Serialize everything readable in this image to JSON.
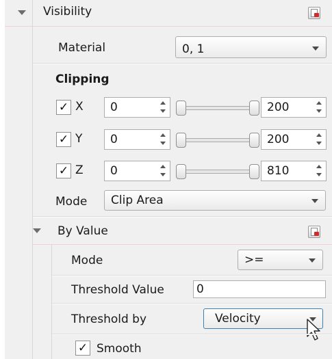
{
  "visibility": {
    "header_label": "Visibility",
    "material_label": "Material",
    "material_value": "0, 1",
    "clipping_title": "Clipping",
    "axes": [
      {
        "label": "X",
        "checked": true,
        "checkmark": "✓",
        "min": "0",
        "max": "200",
        "min_fraction": 0,
        "max_fraction": 1
      },
      {
        "label": "Y",
        "checked": true,
        "checkmark": "✓",
        "min": "0",
        "max": "200",
        "min_fraction": 0,
        "max_fraction": 1
      },
      {
        "label": "Z",
        "checked": true,
        "checkmark": "✓",
        "min": "0",
        "max": "810",
        "min_fraction": 0,
        "max_fraction": 1
      }
    ],
    "mode_label": "Mode",
    "mode_value": "Clip Area"
  },
  "by_value": {
    "header_label": "By Value",
    "mode_label": "Mode",
    "mode_value": ">=",
    "threshold_value_label": "Threshold Value",
    "threshold_value": "0",
    "threshold_by_label": "Threshold by",
    "threshold_by_value": "Velocity",
    "smooth_label": "Smooth",
    "smooth_checked": true,
    "smooth_checkmark": "✓"
  },
  "icons": {
    "reset": "reset-default-icon",
    "expand": "expanded-triangle-icon",
    "dropdown": "chevron-down-icon",
    "spin_up": "spin-up-icon",
    "spin_down": "spin-down-icon",
    "cursor": "mouse-pointer-icon"
  },
  "colors": {
    "panel_bg": "#f0f0f0",
    "header_separator": "#f1cfd5",
    "active_combo_border": "#3c7fb1",
    "reset_accent": "#d12a2a"
  }
}
